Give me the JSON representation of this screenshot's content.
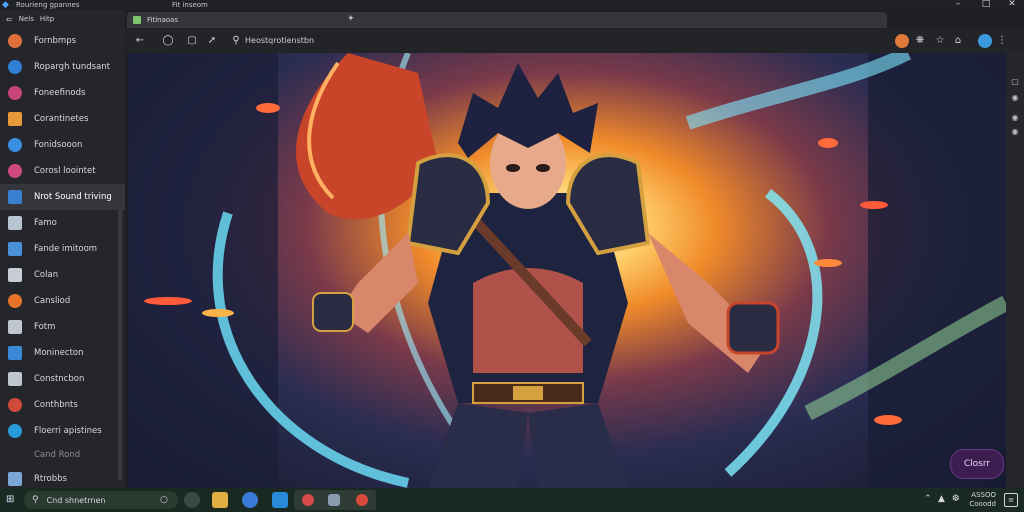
{
  "titlebar": {
    "app_title": "Rourieng gpannes",
    "tab_title": "Fit inseom"
  },
  "menubar": {
    "items": [
      "Nels",
      "Hitp"
    ]
  },
  "sidebar": {
    "items": [
      {
        "label": "Fornbmps",
        "icon": "orange-circle-icon",
        "color": "#e0703a"
      },
      {
        "label": "Ropargh tundsant",
        "icon": "blue-globe-icon",
        "color": "#2f7fd6"
      },
      {
        "label": "Foneefinods",
        "icon": "pink-circle-icon",
        "color": "#c8457a"
      },
      {
        "label": "Corantinetes",
        "icon": "orange-square-icon",
        "color": "#e89a3a"
      },
      {
        "label": "Fonidsooon",
        "icon": "blue-circle-icon",
        "color": "#3a8fe0"
      },
      {
        "label": "Corosl loointet",
        "icon": "pink-wave-icon",
        "color": "#d0497f"
      },
      {
        "label": "Nrot Sound triving",
        "icon": "blue-square-icon",
        "color": "#3a7fd0"
      },
      {
        "label": "Famo",
        "icon": "window-icon",
        "color": "#b8c4d0"
      },
      {
        "label": "Fande imitoom",
        "icon": "blue-window-icon",
        "color": "#4a90d8"
      },
      {
        "label": "Colan",
        "icon": "chat-icon",
        "color": "#c8ccd4"
      },
      {
        "label": "Cansliod",
        "icon": "orange-dot-icon",
        "color": "#e8742a"
      },
      {
        "label": "Fotm",
        "icon": "terminal-icon",
        "color": "#c0c6d0"
      },
      {
        "label": "Moninecton",
        "icon": "blue-tile-icon",
        "color": "#3a8ad8"
      },
      {
        "label": "Constncbon",
        "icon": "list-icon",
        "color": "#c0c6d0"
      },
      {
        "label": "Conthbnts",
        "icon": "chrome-icon",
        "color": "#d04a3a"
      },
      {
        "label": "Floerri apistines",
        "icon": "edge-icon",
        "color": "#2a9ad8"
      },
      {
        "label": "Cand Rond",
        "icon": "",
        "color": ""
      },
      {
        "label": "Rtrobbs",
        "icon": "cube-icon",
        "color": "#7aa6d8"
      }
    ]
  },
  "browser": {
    "tab_label": "Fitinaoas",
    "address_text": "Heostqrotienstbn"
  },
  "content": {
    "chat_button_label": "Closrr"
  },
  "taskbar": {
    "search_text": "Cnd shnetrnen",
    "clock_line1": "ASSOO",
    "clock_line2": "Cooodd"
  }
}
